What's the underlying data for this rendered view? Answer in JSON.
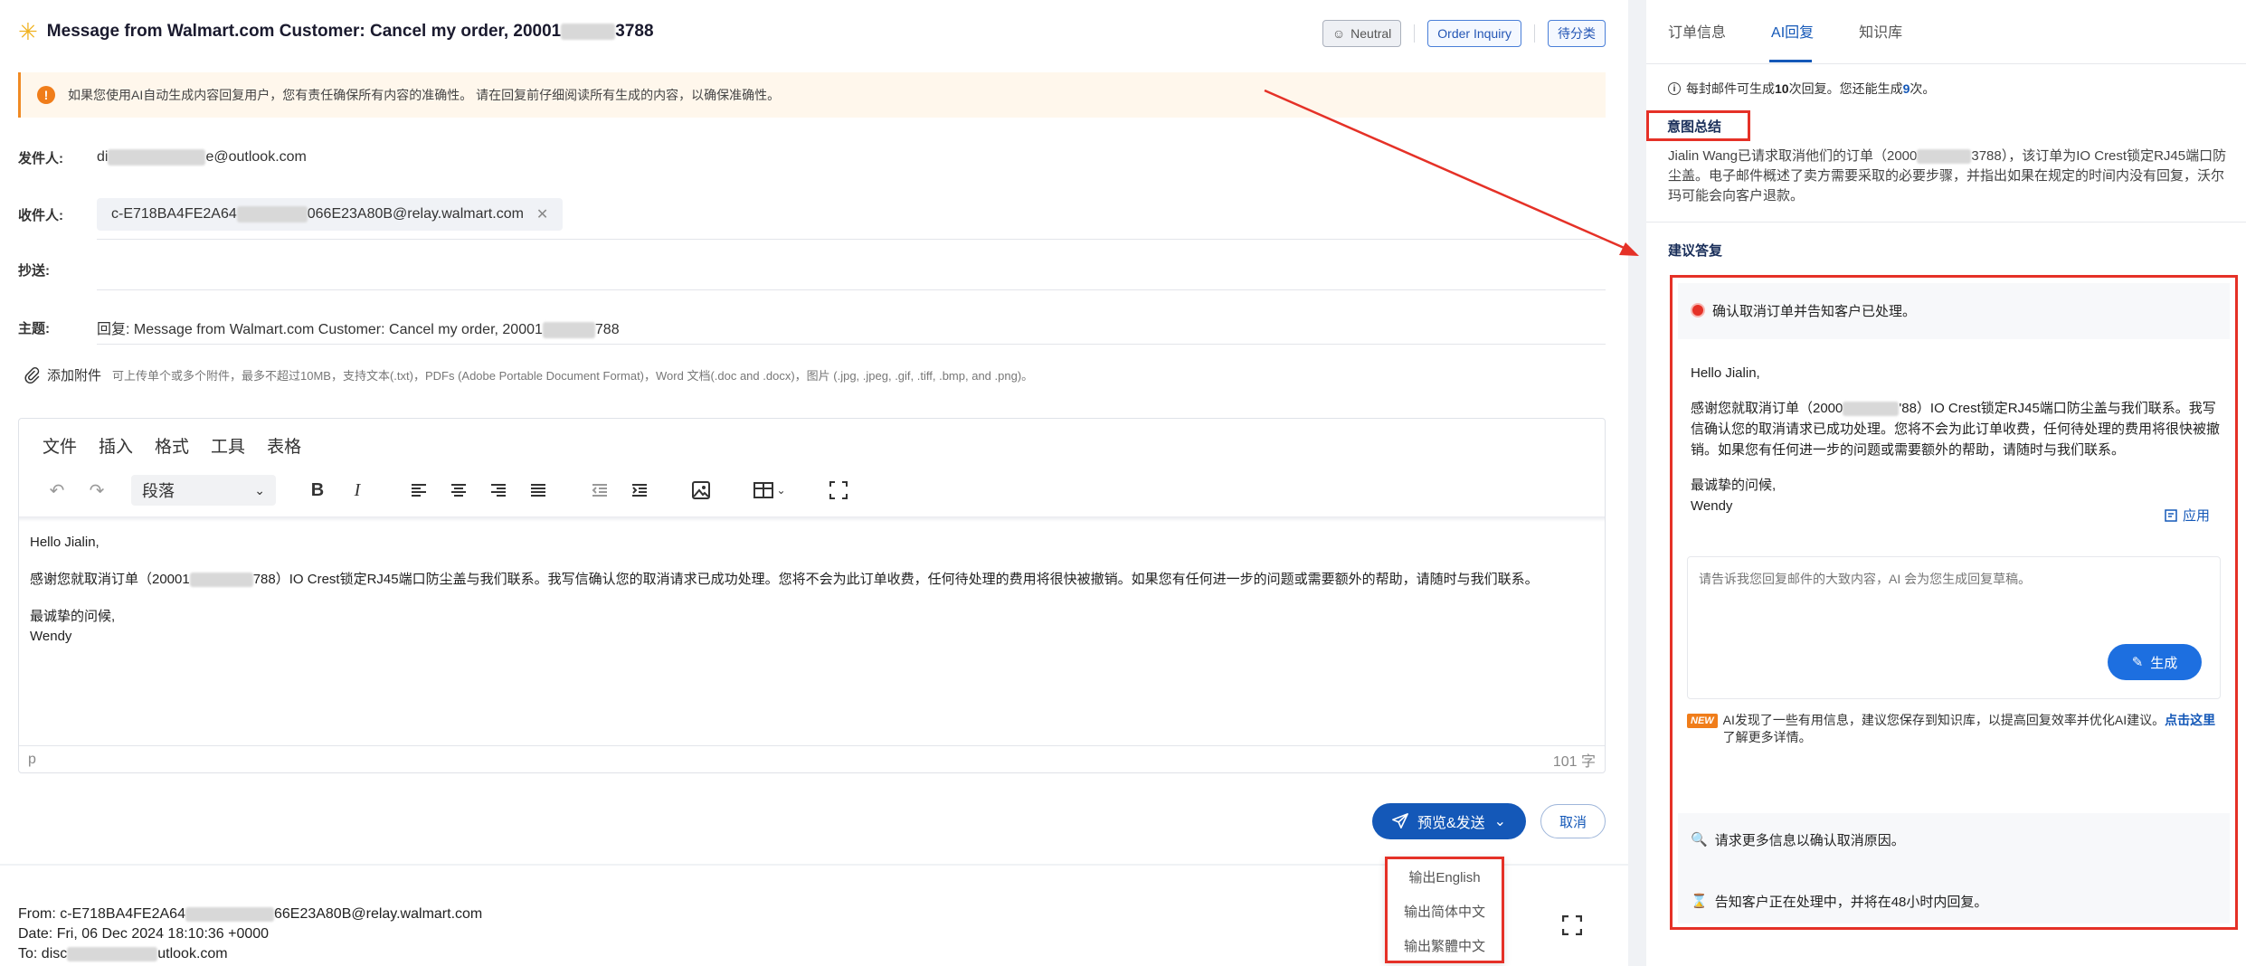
{
  "email": {
    "title_prefix": "Message from Walmart.com Customer: Cancel my order, 20001",
    "title_suffix": "3788",
    "tags": {
      "neutral": "Neutral",
      "category": "Order Inquiry",
      "pending": "待分类"
    },
    "warning": "如果您使用AI自动生成内容回复用户，您有责任确保所有内容的准确性。 请在回复前仔细阅读所有生成的内容，以确保准确性。",
    "fields": {
      "from_label": "发件人:",
      "from_prefix": "di",
      "from_suffix": "e@outlook.com",
      "to_label": "收件人:",
      "to_prefix": "c-E718BA4FE2A64",
      "to_suffix": "066E23A80B@relay.walmart.com",
      "cc_label": "抄送:",
      "subject_label": "主题:",
      "subject_prefix": "回复: Message from Walmart.com Customer:  Cancel my order, 20001",
      "subject_suffix": "788"
    },
    "attach": {
      "label": "添加附件",
      "hint": "可上传单个或多个附件，最多不超过10MB，支持文本(.txt)，PDFs (Adobe Portable Document Format)，Word 文档(.doc and .docx)，图片 (.jpg, .jpeg, .gif, .tiff, .bmp, and .png)。"
    }
  },
  "editor": {
    "menu": [
      "文件",
      "插入",
      "格式",
      "工具",
      "表格"
    ],
    "block_format": "段落",
    "body": {
      "greeting": "Hello Jialin,",
      "para_prefix": "感谢您就取消订单（20001",
      "para_suffix": "788）IO Crest锁定RJ45端口防尘盖与我们联系。我写信确认您的取消请求已成功处理。您将不会为此订单收费，任何待处理的费用将很快被撤销。如果您有任何进一步的问题或需要额外的帮助，请随时与我们联系。",
      "closing": "最诚挚的问候,",
      "name": "Wendy"
    },
    "status_path": "p",
    "word_count": "101 字"
  },
  "actions": {
    "send": "预览&发送",
    "cancel": "取消",
    "dropdown": [
      "输出English",
      "输出简体中文",
      "输出繁體中文"
    ]
  },
  "original": {
    "from_prefix": "From: c-E718BA4FE2A64",
    "from_suffix": "66E23A80B@relay.walmart.com",
    "date": "Date: Fri, 06 Dec 2024 18:10:36 +0000",
    "to_prefix": "To: disc",
    "to_suffix": "utlook.com"
  },
  "panel": {
    "tabs": [
      "订单信息",
      "AI回复",
      "知识库"
    ],
    "active_tab": "AI回复",
    "quota": {
      "text1": "每封邮件可生成",
      "count_total": "10",
      "text2": "次回复。您还能生成",
      "count_left": "9",
      "text3": "次。"
    },
    "intent_title": "意图总结",
    "summary_prefix": "Jialin Wang已请求取消他们的订单（2000",
    "summary_suffix": "3788），该订单为IO Crest锁定RJ45端口防尘盖。电子邮件概述了卖方需要采取的必要步骤，并指出如果在规定的时间内没有回复，沃尔玛可能会向客户退款。",
    "suggest_title": "建议答复",
    "option1": "确认取消订单并告知客户已处理。",
    "reply": {
      "greeting": "Hello Jialin,",
      "para_prefix": "感谢您就取消订单（2000",
      "para_suffix": "'88）IO Crest锁定RJ45端口防尘盖与我们联系。我写信确认您的取消请求已成功处理。您将不会为此订单收费，任何待处理的费用将很快被撤销。如果您有任何进一步的问题或需要额外的帮助，请随时与我们联系。",
      "closing": "最诚挚的问候,",
      "name": "Wendy"
    },
    "apply": "应用",
    "prompt_placeholder": "请告诉我您回复邮件的大致内容，AI 会为您生成回复草稿。",
    "generate": "生成",
    "new_badge": "NEW",
    "tip_text": "AI发现了一些有用信息，建议您保存到知识库，以提高回复效率并优化AI建议。",
    "tip_link": "点击这里",
    "tip_more": "了解更多详情。",
    "option2": "请求更多信息以确认取消原因。",
    "option3": "告知客户正在处理中，并将在48小时内回复。"
  },
  "colors": {
    "primary": "#1458b8",
    "annotation_red": "#e53127",
    "warning_orange": "#f07d1a"
  }
}
